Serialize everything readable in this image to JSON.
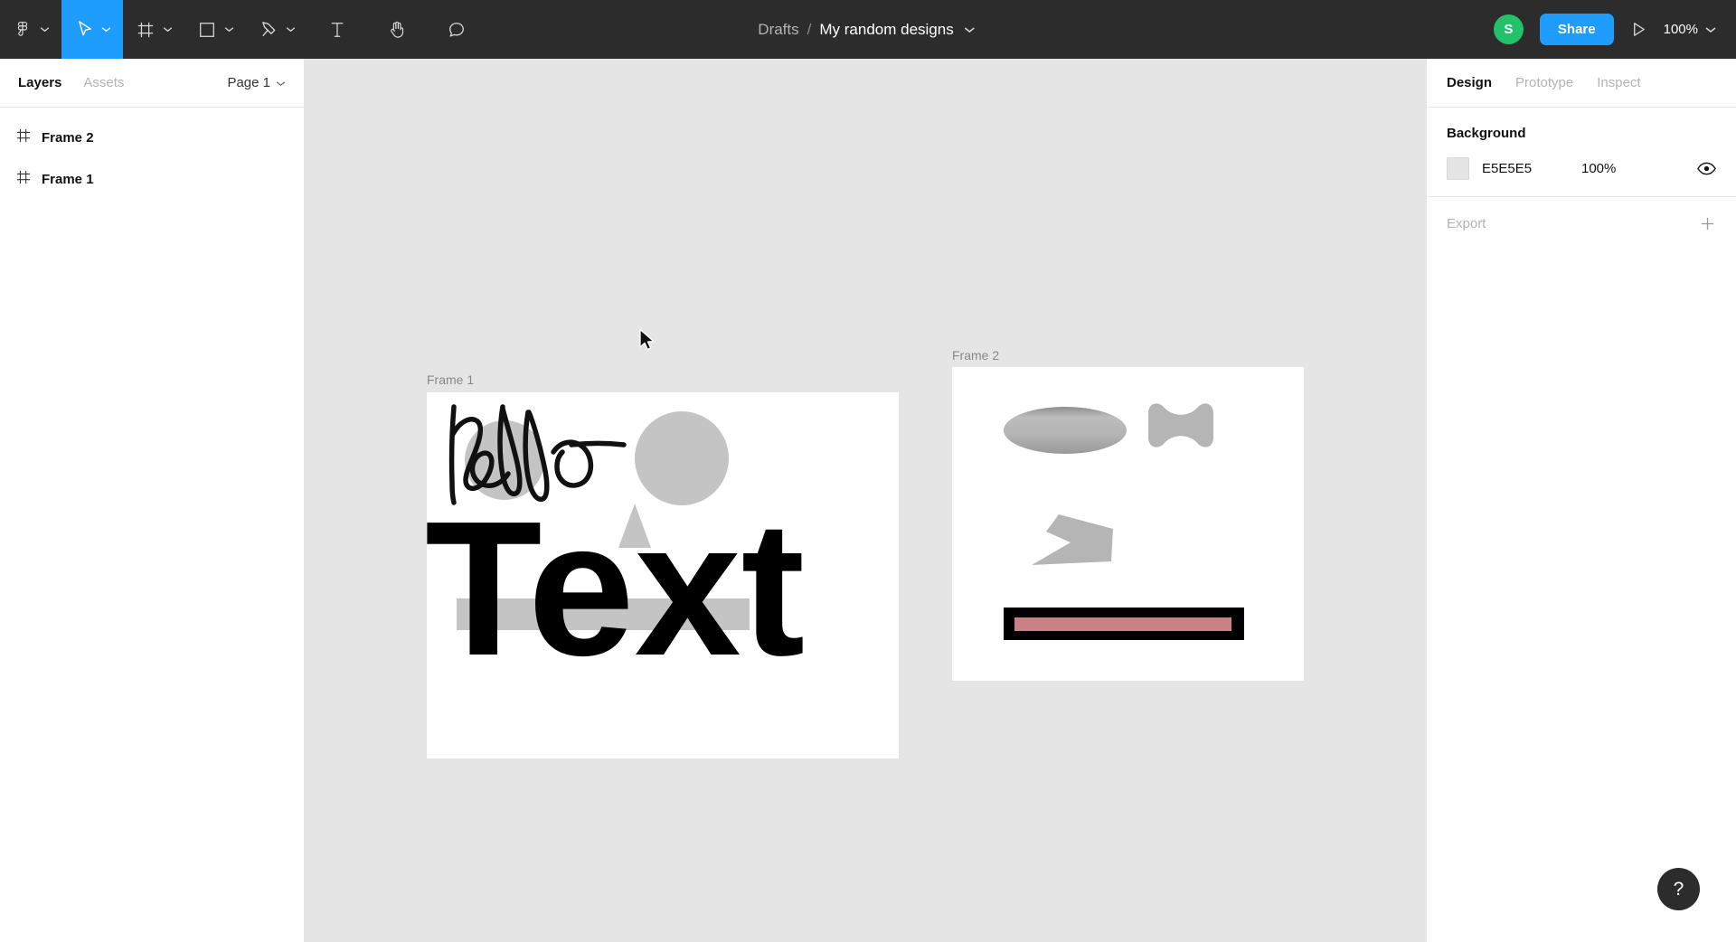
{
  "toolbar": {
    "tools": [
      {
        "name": "figma-logo-icon",
        "label": "Figma menu",
        "has_chevron": true,
        "active": false
      },
      {
        "name": "move-tool-icon",
        "label": "Move",
        "has_chevron": true,
        "active": true
      },
      {
        "name": "frame-tool-icon",
        "label": "Frame",
        "has_chevron": true,
        "active": false
      },
      {
        "name": "shape-tool-icon",
        "label": "Rectangle",
        "has_chevron": true,
        "active": false
      },
      {
        "name": "pen-tool-icon",
        "label": "Pen",
        "has_chevron": true,
        "active": false
      },
      {
        "name": "text-tool-icon",
        "label": "Text",
        "has_chevron": false,
        "active": false
      },
      {
        "name": "hand-tool-icon",
        "label": "Hand",
        "has_chevron": false,
        "active": false
      },
      {
        "name": "comment-tool-icon",
        "label": "Comment",
        "has_chevron": false,
        "active": false
      }
    ],
    "breadcrumb_parent": "Drafts",
    "breadcrumb_separator": "/",
    "file_title": "My random designs",
    "avatar_initial": "S",
    "avatar_color": "#24C16B",
    "share_label": "Share",
    "present_icon": "play-icon",
    "zoom_level": "100%",
    "accent_color": "#1E9DFF",
    "background_color": "#2C2C2C"
  },
  "left_panel": {
    "tabs": [
      {
        "label": "Layers",
        "active": true
      },
      {
        "label": "Assets",
        "active": false
      }
    ],
    "page_selector": "Page 1",
    "layers": [
      {
        "icon": "frame-icon",
        "name": "Frame 2"
      },
      {
        "icon": "frame-icon",
        "name": "Frame 1"
      }
    ]
  },
  "canvas": {
    "background_color": "#E5E5E5",
    "cursor_icon": "arrow-pointer-cursor",
    "frames": [
      {
        "label": "Frame 1",
        "background": "#FFFFFF",
        "objects": [
          {
            "type": "vector-scribble",
            "name": "hello-scribble",
            "stroke": "#111111"
          },
          {
            "type": "ellipse",
            "name": "gray-circle-left",
            "fill": "#C4C4C4"
          },
          {
            "type": "ellipse",
            "name": "gray-circle-right",
            "fill": "#C4C4C4"
          },
          {
            "type": "polygon",
            "name": "gray-triangle",
            "fill": "#C4C4C4"
          },
          {
            "type": "rectangle",
            "name": "gray-bar",
            "fill": "#C4C4C4"
          },
          {
            "type": "text",
            "name": "text-layer",
            "content": "Text",
            "fill": "#000000"
          }
        ]
      },
      {
        "label": "Frame 2",
        "background": "#FFFFFF",
        "objects": [
          {
            "type": "ellipse",
            "name": "gradient-ellipse",
            "fill": "#A8A8A8"
          },
          {
            "type": "vector",
            "name": "bowtie-shape",
            "fill": "#B5B5B5"
          },
          {
            "type": "polygon",
            "name": "arrow-shape",
            "fill": "#B5B5B5"
          },
          {
            "type": "rectangle",
            "name": "black-bar",
            "fill": "#000000"
          },
          {
            "type": "rectangle",
            "name": "pink-inner-bar",
            "fill": "#C98086"
          }
        ]
      }
    ]
  },
  "right_panel": {
    "tabs": [
      {
        "label": "Design",
        "active": true
      },
      {
        "label": "Prototype",
        "active": false
      },
      {
        "label": "Inspect",
        "active": false
      }
    ],
    "background_section": {
      "title": "Background",
      "color_hex": "E5E5E5",
      "opacity": "100%",
      "visibility_icon": "eye-icon"
    },
    "export_section": {
      "title": "Export",
      "add_icon": "plus-icon"
    }
  },
  "help": {
    "label": "?"
  }
}
